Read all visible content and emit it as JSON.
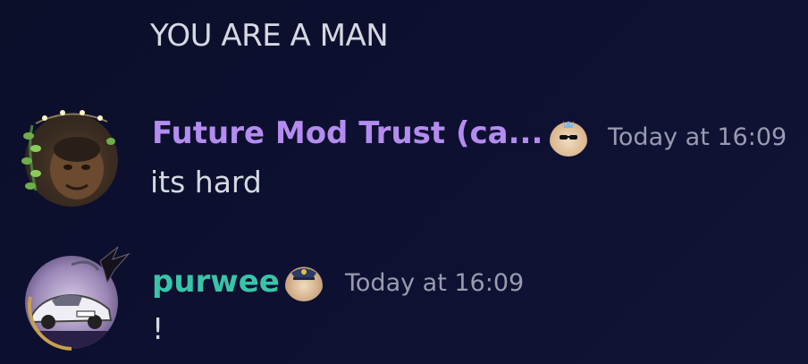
{
  "previous_message": {
    "text": "YOU ARE A MAN"
  },
  "messages": [
    {
      "username": "Future Mod Trust (ca...",
      "timestamp": "Today at 16:09",
      "text": "its hard",
      "username_color": "#b48cf0",
      "badge_icon": "cat-sunglasses-crown-icon"
    },
    {
      "username": "purwee",
      "timestamp": "Today at 16:09",
      "text": "!",
      "username_color": "#39c4a9",
      "badge_icon": "cat-police-hat-icon"
    }
  ],
  "colors": {
    "background": "#0d1030",
    "text": "#d6d8e2",
    "timestamp": "#9a9bb0"
  }
}
